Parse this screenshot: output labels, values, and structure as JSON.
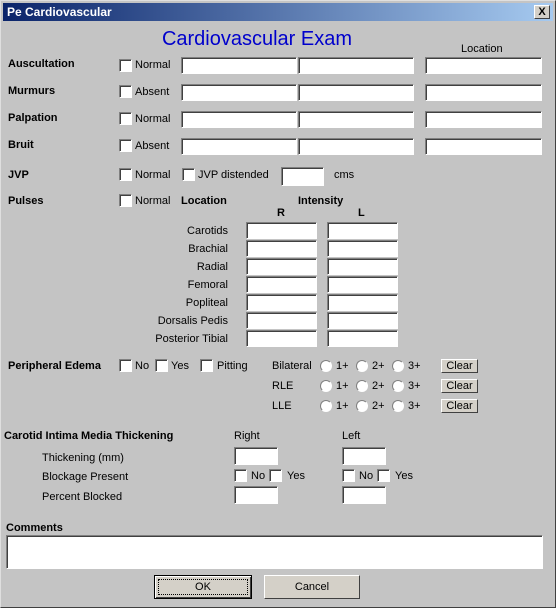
{
  "window": {
    "title": "Pe Cardiovascular",
    "close_label": "X"
  },
  "heading": "Cardiovascular Exam",
  "location_header": "Location",
  "rows": [
    {
      "label": "Auscultation",
      "checkbox": "Normal"
    },
    {
      "label": "Murmurs",
      "checkbox": "Absent"
    },
    {
      "label": "Palpation",
      "checkbox": "Normal"
    },
    {
      "label": "Bruit",
      "checkbox": "Absent"
    }
  ],
  "jvp": {
    "label": "JVP",
    "normal": "Normal",
    "distended": "JVP distended",
    "value": "",
    "unit": "cms"
  },
  "pulses": {
    "label": "Pulses",
    "normal": "Normal",
    "location_header": "Location",
    "intensity_header": "Intensity",
    "r_header": "R",
    "l_header": "L",
    "locations": [
      "Carotids",
      "Brachial",
      "Radial",
      "Femoral",
      "Popliteal",
      "Dorsalis Pedis",
      "Posterior Tibial"
    ]
  },
  "edema": {
    "label": "Peripheral Edema",
    "no": "No",
    "yes": "Yes",
    "pitting": "Pitting",
    "rows": [
      {
        "label": "Bilateral",
        "options": [
          "1+",
          "2+",
          "3+"
        ],
        "clear": "Clear"
      },
      {
        "label": "RLE",
        "options": [
          "1+",
          "2+",
          "3+"
        ],
        "clear": "Clear"
      },
      {
        "label": "LLE",
        "options": [
          "1+",
          "2+",
          "3+"
        ],
        "clear": "Clear"
      }
    ]
  },
  "cimt": {
    "label": "Carotid Intima Media Thickening",
    "right": "Right",
    "left": "Left",
    "thickening": "Thickening (mm)",
    "blockage": "Blockage Present",
    "percent": "Percent Blocked",
    "no": "No",
    "yes": "Yes"
  },
  "comments": {
    "label": "Comments",
    "value": ""
  },
  "buttons": {
    "ok": "OK",
    "cancel": "Cancel"
  }
}
